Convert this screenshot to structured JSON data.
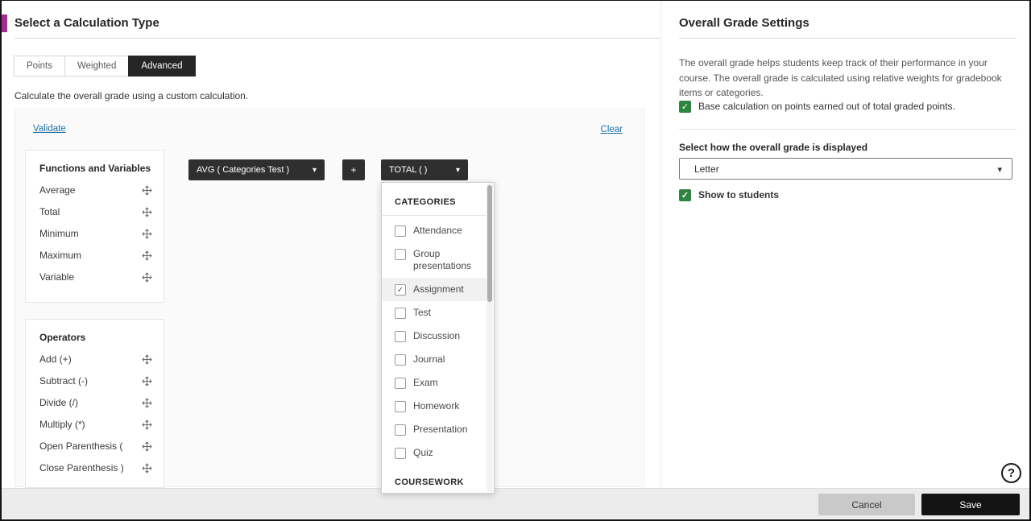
{
  "colors": {
    "accent_magenta": "#a02c94",
    "checkbox_green": "#2e8540",
    "pill_dark": "#2f2f2f",
    "link_blue": "#1f6fa8",
    "active_tab_bg": "#262626"
  },
  "left": {
    "title": "Select a Calculation Type",
    "tabs": [
      {
        "label": "Points",
        "active": false
      },
      {
        "label": "Weighted",
        "active": false
      },
      {
        "label": "Advanced",
        "active": true
      }
    ],
    "description": "Calculate the overall grade using a custom calculation.",
    "validate_link": "Validate",
    "clear_link": "Clear",
    "functions": {
      "title": "Functions and Variables",
      "items": [
        "Average",
        "Total",
        "Minimum",
        "Maximum",
        "Variable"
      ]
    },
    "operators": {
      "title": "Operators",
      "items": [
        "Add (+)",
        "Subtract (-)",
        "Divide (/)",
        "Multiply (*)",
        "Open Parenthesis (",
        "Close Parenthesis )"
      ]
    },
    "expression": {
      "avg_pill": "AVG ( Categories Test )",
      "plus_pill": "+",
      "total_pill": "TOTAL ( )"
    },
    "dropdown": {
      "categories_header": "CATEGORIES",
      "coursework_header": "COURSEWORK",
      "items": [
        {
          "label": "Attendance",
          "checked": false
        },
        {
          "label": "Group presentations",
          "checked": false
        },
        {
          "label": "Assignment",
          "checked": true
        },
        {
          "label": "Test",
          "checked": false
        },
        {
          "label": "Discussion",
          "checked": false
        },
        {
          "label": "Journal",
          "checked": false
        },
        {
          "label": "Exam",
          "checked": false
        },
        {
          "label": "Homework",
          "checked": false
        },
        {
          "label": "Presentation",
          "checked": false
        },
        {
          "label": "Quiz",
          "checked": false
        }
      ]
    }
  },
  "right": {
    "title": "Overall Grade Settings",
    "description": "The overall grade helps students keep track of their performance in your course. The overall grade is calculated using relative weights for gradebook items or categories.",
    "base_calculation": {
      "label": "Base calculation on points earned out of total graded points.",
      "checked": true
    },
    "display_label": "Select how the overall grade is displayed",
    "display_value": "Letter",
    "show_to_students": {
      "label": "Show to students",
      "checked": true
    }
  },
  "footer": {
    "cancel_label": "Cancel",
    "save_label": "Save"
  },
  "help_icon": "?"
}
